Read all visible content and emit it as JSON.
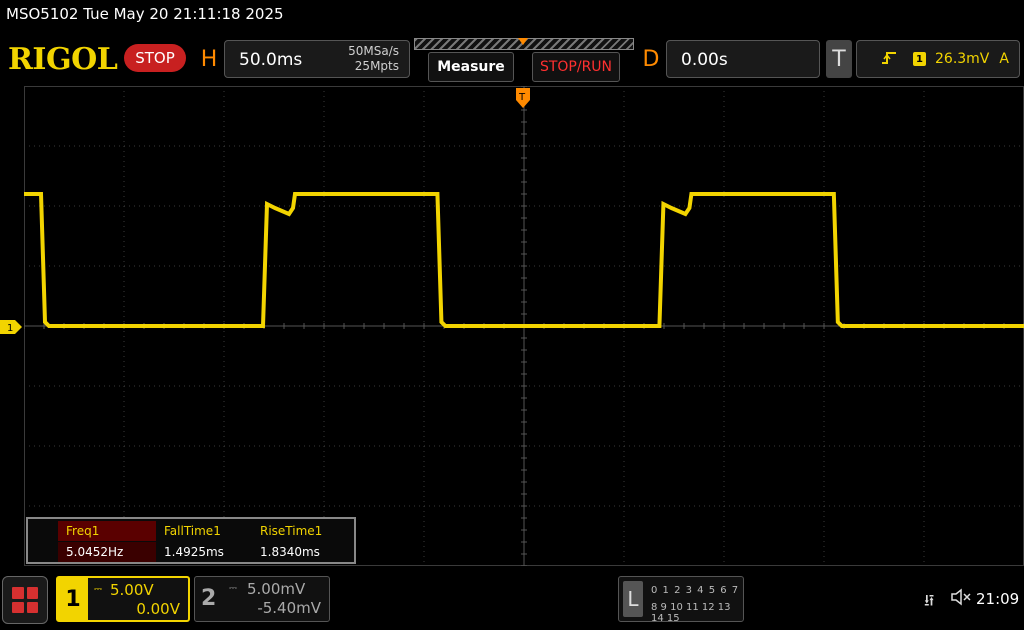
{
  "title_bar": {
    "text": "MSO5102  Tue May 20 21:11:18 2025"
  },
  "toolbar": {
    "logo": "RIGOL",
    "run_state": "STOP",
    "horizontal": {
      "letter": "H",
      "timebase": "50.0ms",
      "sample_rate": "50MSa/s",
      "memory_depth": "25Mpts"
    },
    "measure_label": "Measure",
    "stop_run_label": "STOP/RUN",
    "delay": {
      "letter": "D",
      "value": "0.00s"
    },
    "trigger": {
      "letter": "T",
      "edge_icon": "rising-edge-icon",
      "source": "1",
      "level": "26.3mV",
      "mode": "A"
    }
  },
  "screen": {
    "ch1_marker": "1",
    "waveform": {
      "channel": 1,
      "color": "#f2d400",
      "type": "square",
      "frequency_hz": 5.0452,
      "high_level_divisions": 2.2,
      "low_level_divisions": 0.0
    },
    "grid": {
      "columns": 10,
      "rows": 8,
      "background": "#000000",
      "grid_color": "#3a3a3a"
    }
  },
  "measurements": {
    "headers": [
      "Freq1",
      "FallTime1",
      "RiseTime1"
    ],
    "values": [
      "5.0452Hz",
      "1.4925ms",
      "1.8340ms"
    ]
  },
  "channels": {
    "ch1": {
      "number": "1",
      "scale": "5.00V",
      "offset": "0.00V",
      "color": "#f2d400"
    },
    "ch2": {
      "number": "2",
      "scale": "5.00mV",
      "offset": "-5.40mV",
      "color": "#aaaaaa"
    }
  },
  "logic_analyzer": {
    "letter": "L",
    "row1": "0 1 2 3  4 5 6 7",
    "row2": "8 9 10 11 12 13 14 15"
  },
  "status": {
    "time": "21:09",
    "usb_icon": "usb-icon",
    "sound_icon": "speaker-muted-icon"
  },
  "colors": {
    "accent": "#f2d400",
    "orange": "#ff8a00",
    "stop_red": "#c82020"
  }
}
